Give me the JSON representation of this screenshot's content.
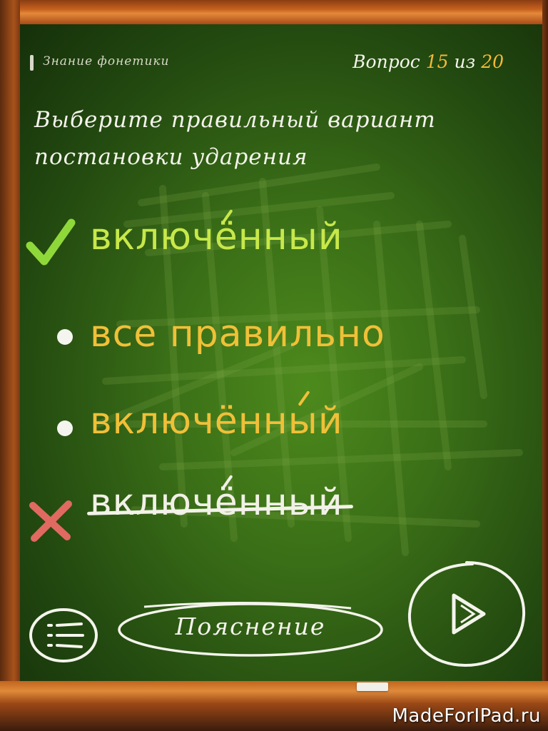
{
  "header": {
    "category": "Знание фонетики",
    "counter_prefix": "Вопрос",
    "current": "15",
    "separator": "из",
    "total": "20"
  },
  "question": "Выберите правильный вариант постановки ударения",
  "answers": [
    {
      "text": "включённый",
      "state": "correct"
    },
    {
      "text": "все правильно",
      "state": "neutral"
    },
    {
      "text": "включённый",
      "state": "neutral"
    },
    {
      "text": "включённый",
      "state": "wrong"
    }
  ],
  "buttons": {
    "explain": "Пояснение",
    "menu_icon": "menu-list-icon",
    "next_icon": "play-icon"
  },
  "watermark": "MadeForIPad.ru",
  "colors": {
    "board": "#3a6e17",
    "correct": "#c8e84a",
    "answer": "#f0c038",
    "wrong_mark": "#e06a62",
    "chalk": "#f4f4ec"
  }
}
